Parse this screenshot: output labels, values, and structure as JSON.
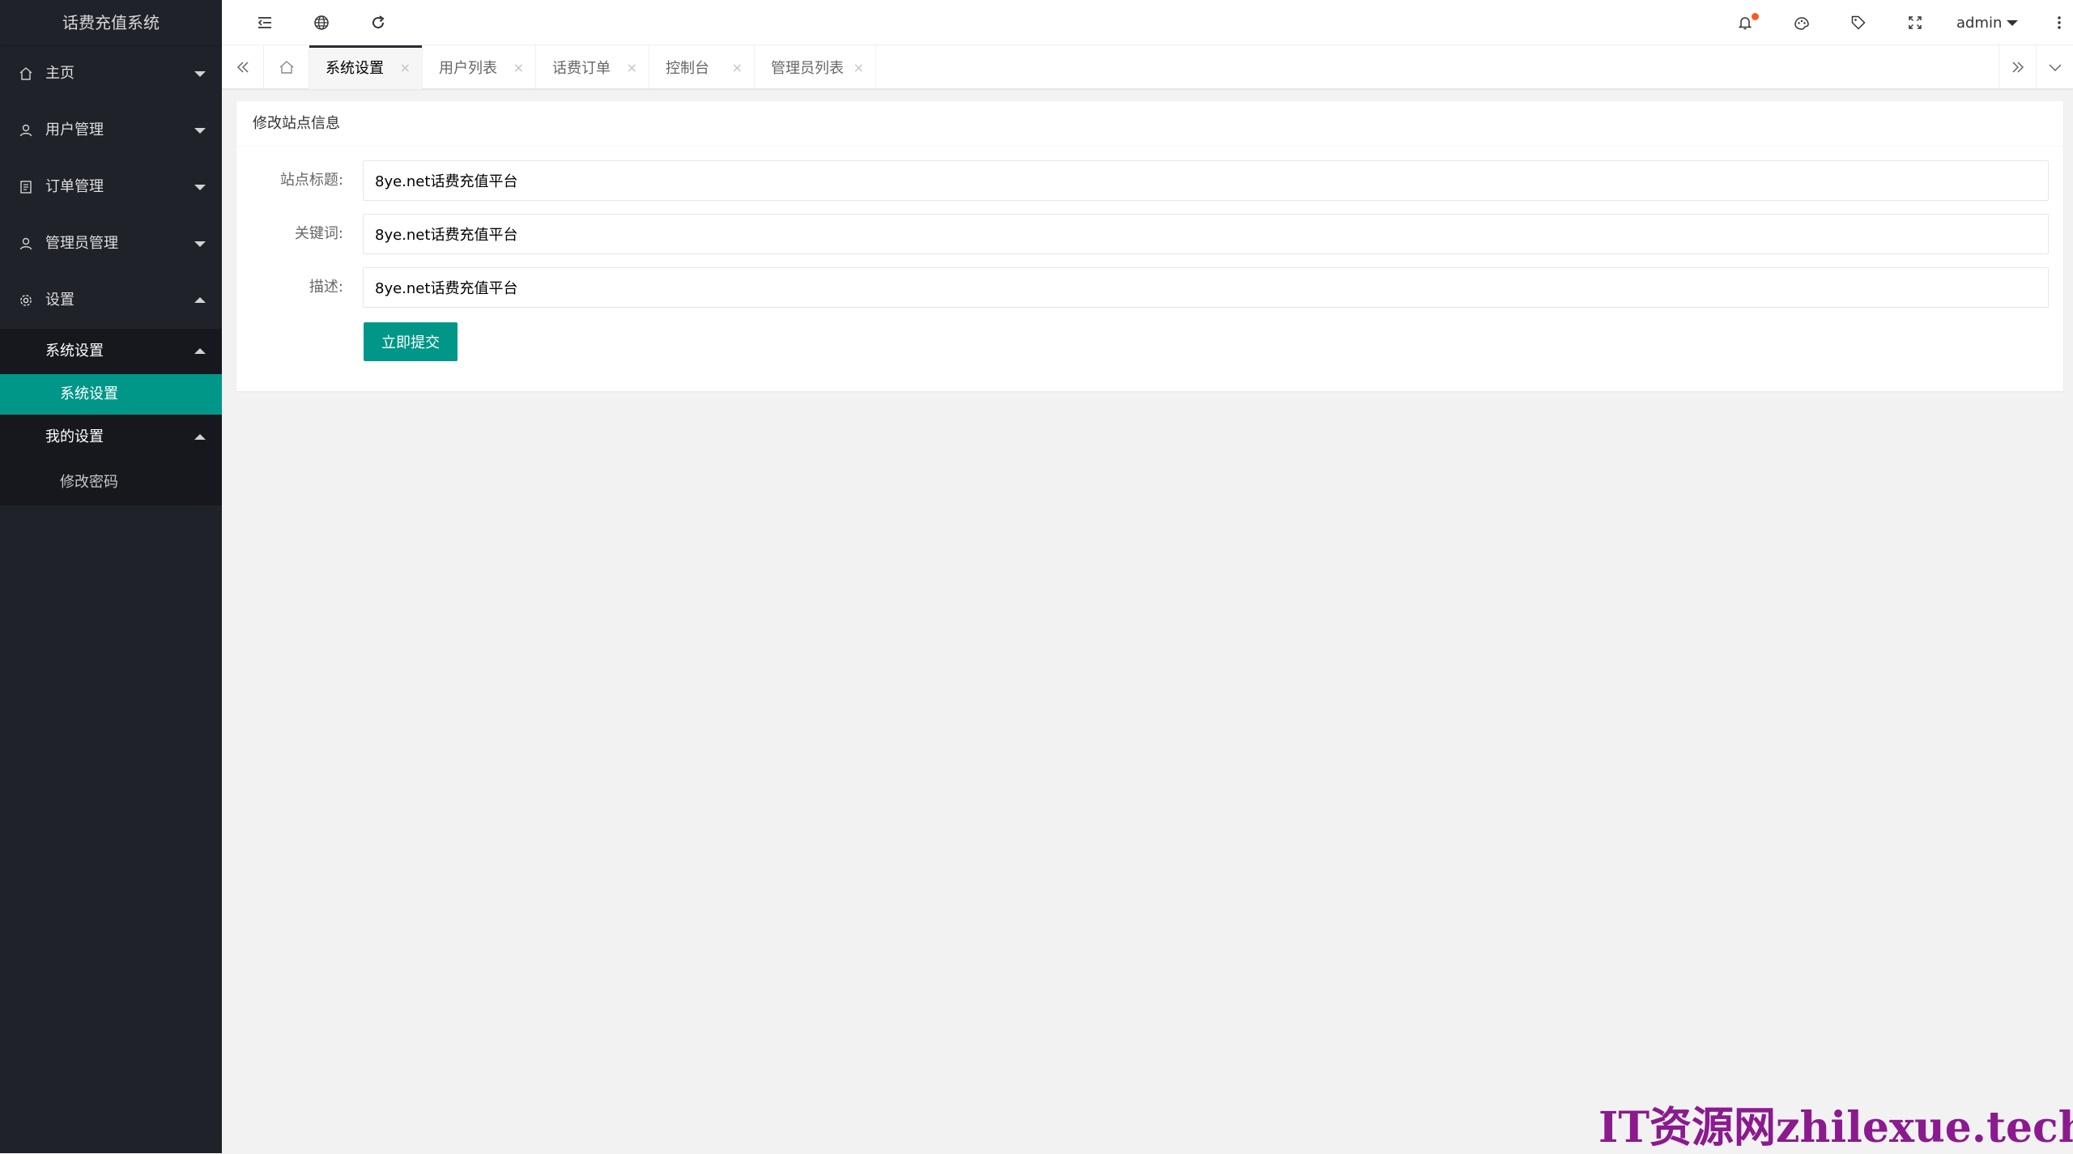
{
  "app": {
    "title": "话费充值系统"
  },
  "sidebar": {
    "items": [
      {
        "label": "主页",
        "icon": "home-icon",
        "expanded": false
      },
      {
        "label": "用户管理",
        "icon": "user-icon",
        "expanded": false
      },
      {
        "label": "订单管理",
        "icon": "order-icon",
        "expanded": false
      },
      {
        "label": "管理员管理",
        "icon": "admin-icon",
        "expanded": false
      },
      {
        "label": "设置",
        "icon": "gear-icon",
        "expanded": true
      }
    ],
    "settings_children": [
      {
        "label": "系统设置",
        "expanded": true,
        "children": [
          {
            "label": "系统设置",
            "active": true
          }
        ]
      },
      {
        "label": "我的设置",
        "expanded": true,
        "children": [
          {
            "label": "修改密码",
            "active": false
          }
        ]
      }
    ]
  },
  "header": {
    "icons": [
      "menu-fold-icon",
      "globe-icon",
      "refresh-icon",
      "bell-icon",
      "theme-icon",
      "tag-icon",
      "fullscreen-icon",
      "more-icon"
    ],
    "user": "admin",
    "notification_dot_color": "#ff5722"
  },
  "tabs": {
    "items": [
      {
        "label": "系统设置",
        "active": true
      },
      {
        "label": "用户列表",
        "active": false
      },
      {
        "label": "话费订单",
        "active": false
      },
      {
        "label": "控制台",
        "active": false
      },
      {
        "label": "管理员列表",
        "active": false
      }
    ],
    "close_glyph": "×"
  },
  "form": {
    "title": "修改站点信息",
    "fields": [
      {
        "label": "站点标题:",
        "value": "8ye.net话费充值平台"
      },
      {
        "label": "关键词:",
        "value": "8ye.net话费充值平台"
      },
      {
        "label": "描述:",
        "value": "8ye.net话费充值平台"
      }
    ],
    "submit_label": "立即提交"
  },
  "watermark": {
    "text": "IT资源网zhilexue.tech"
  },
  "colors": {
    "accent": "#009688",
    "sidebar_bg": "#20222a",
    "sidebar_child_bg": "#17181e",
    "watermark": "#8b1a8f"
  }
}
